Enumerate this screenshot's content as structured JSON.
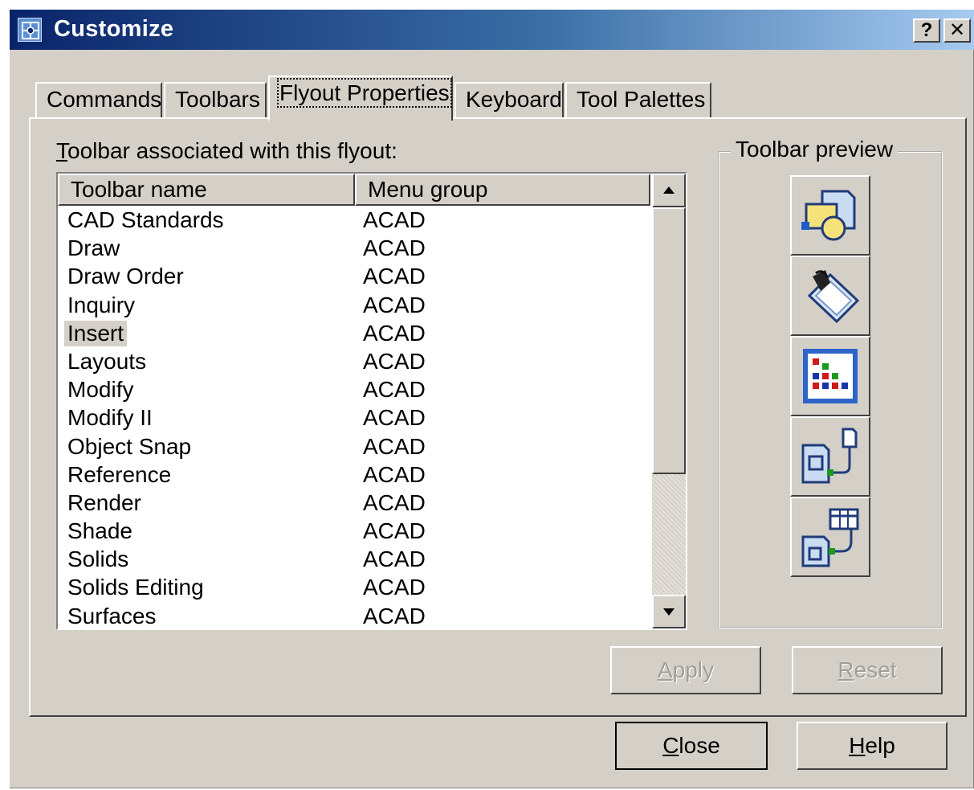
{
  "window": {
    "title": "Customize",
    "help_glyph": "?",
    "close_glyph": "✕",
    "title_gradient_start": "#0a246a",
    "title_gradient_end": "#a6caf0"
  },
  "tabs": [
    {
      "label": "Commands",
      "active": false
    },
    {
      "label": "Toolbars",
      "active": false
    },
    {
      "label": "Flyout Properties",
      "active": true
    },
    {
      "label": "Keyboard",
      "active": false
    },
    {
      "label": "Tool Palettes",
      "active": false
    }
  ],
  "flyout": {
    "caption_mnemonic": "T",
    "caption_rest": "oolbar associated with this flyout:",
    "columns": {
      "name": "Toolbar name",
      "group": "Menu group"
    },
    "rows": [
      {
        "name": "CAD Standards",
        "group": "ACAD"
      },
      {
        "name": "Draw",
        "group": "ACAD"
      },
      {
        "name": "Draw Order",
        "group": "ACAD"
      },
      {
        "name": "Inquiry",
        "group": "ACAD"
      },
      {
        "name": "Insert",
        "group": "ACAD",
        "selected": true
      },
      {
        "name": "Layouts",
        "group": "ACAD"
      },
      {
        "name": "Modify",
        "group": "ACAD"
      },
      {
        "name": "Modify II",
        "group": "ACAD"
      },
      {
        "name": "Object Snap",
        "group": "ACAD"
      },
      {
        "name": "Reference",
        "group": "ACAD"
      },
      {
        "name": "Render",
        "group": "ACAD"
      },
      {
        "name": "Shade",
        "group": "ACAD"
      },
      {
        "name": "Solids",
        "group": "ACAD"
      },
      {
        "name": "Solids Editing",
        "group": "ACAD"
      },
      {
        "name": "Surfaces",
        "group": "ACAD"
      }
    ],
    "preview": {
      "label": "Toolbar preview",
      "icons": [
        "insert-block-icon",
        "external-reference-icon",
        "raster-image-icon",
        "attach-image-icon",
        "ole-object-icon"
      ]
    },
    "apply_mnemonic": "A",
    "apply_rest": "pply",
    "reset_mnemonic": "R",
    "reset_rest": "eset"
  },
  "footer": {
    "close_mnemonic": "C",
    "close_rest": "lose",
    "help_mnemonic": "H",
    "help_rest": "elp"
  }
}
